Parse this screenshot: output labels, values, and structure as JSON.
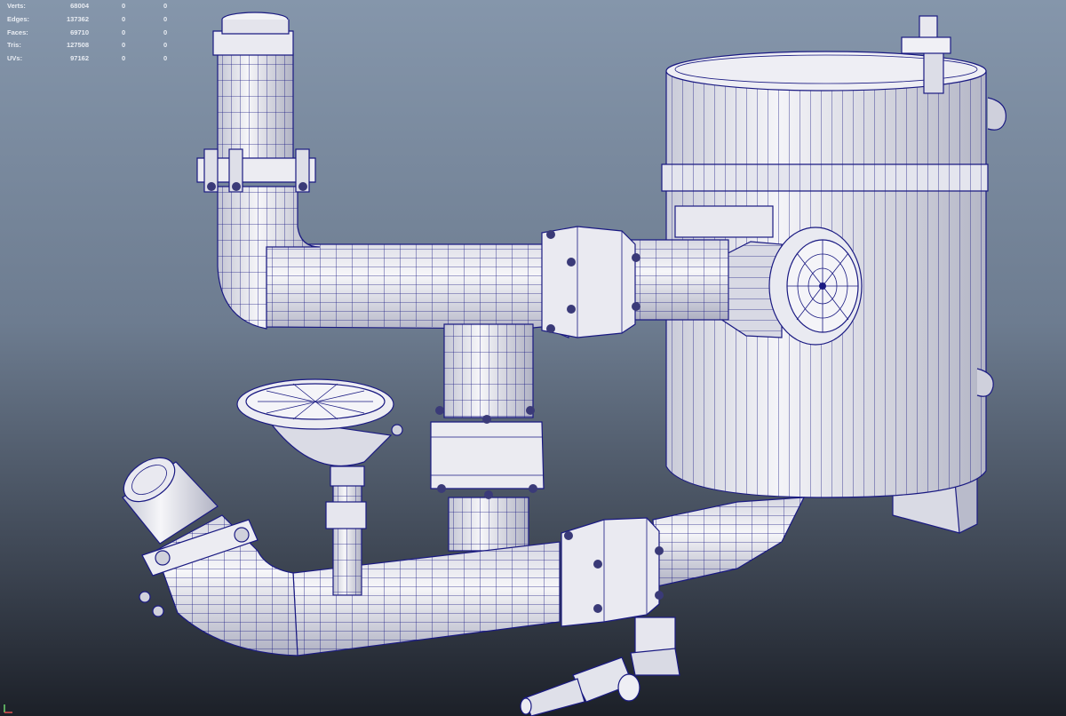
{
  "hud": {
    "rows": [
      {
        "label": "Verts:",
        "v1": "68004",
        "v2": "0",
        "v3": "0"
      },
      {
        "label": "Edges:",
        "v1": "137362",
        "v2": "0",
        "v3": "0"
      },
      {
        "label": "Faces:",
        "v1": "69710",
        "v2": "0",
        "v3": "0"
      },
      {
        "label": "Tris:",
        "v1": "127508",
        "v2": "0",
        "v3": "0"
      },
      {
        "label": "UVs:",
        "v1": "97162",
        "v2": "0",
        "v3": "0"
      }
    ]
  },
  "colors": {
    "background_top": "#8596ab",
    "background_bottom": "#1c2028",
    "wireframe": "#1a1a82",
    "surface": "#ececf2",
    "hud_text": "#e8ecf2"
  }
}
